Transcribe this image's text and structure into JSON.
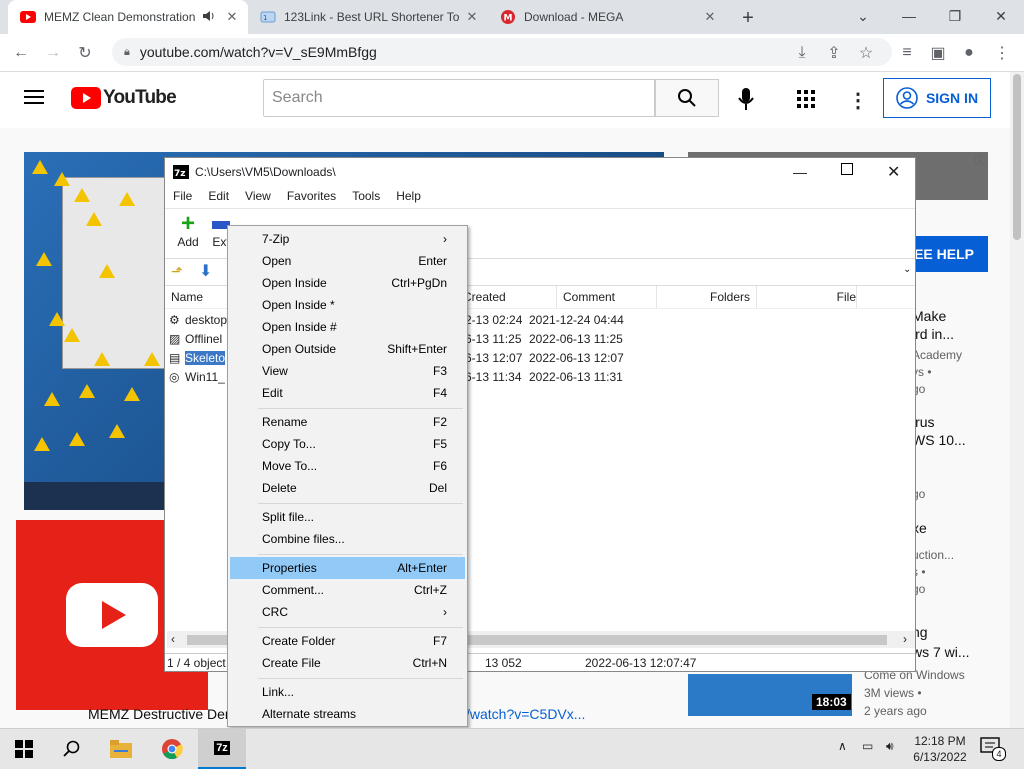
{
  "browser": {
    "tabs": [
      {
        "title": "MEMZ Clean Demonstration",
        "active": true,
        "favicon": "youtube-icon"
      },
      {
        "title": "123Link - Best URL Shortener To",
        "active": false,
        "favicon": "link-icon"
      },
      {
        "title": "Download - MEGA",
        "active": false,
        "favicon": "mega-icon"
      }
    ],
    "url": "youtube.com/watch?v=V_sE9MmBfgg"
  },
  "youtube": {
    "logo_text": "YouTube",
    "search_placeholder": "Search",
    "signin_label": "SIGN IN",
    "help_button": "SEE HELP",
    "sidebar": [
      {
        "title_line1": "Make",
        "title_line2": "ird in...",
        "meta1": "Academy",
        "meta2": "vs •",
        "meta3": "go"
      },
      {
        "title_line1": "irus",
        "title_line2": "WS 10...",
        "meta1": "",
        "meta2": "•",
        "meta3": "go"
      },
      {
        "title_line1": "xe",
        "title_line2": "",
        "meta1": "uction...",
        "meta2": "s •",
        "meta3": "go"
      },
      {
        "title_line1": "ng",
        "title_line2": "ws 7 wi...",
        "meta1": "Come on Windows",
        "meta2": "3M views •",
        "meta3": "2 years ago"
      }
    ],
    "duration": "18:03",
    "below_video_left": "MEMZ Destructive Der",
    "below_video_link": "/watch?v=C5DVx..."
  },
  "sevenzip": {
    "title": "C:\\Users\\VM5\\Downloads\\",
    "menu": [
      "File",
      "Edit",
      "View",
      "Favorites",
      "Tools",
      "Help"
    ],
    "toolbar": [
      "Add",
      "Ext"
    ],
    "columns": [
      "Name",
      "ed",
      "Created",
      "Comment",
      "Folders",
      "File"
    ],
    "rows": [
      {
        "name": "desktop",
        "modified": "2-13 02:24",
        "created": "2021-12-24 04:44"
      },
      {
        "name": "Offlinel",
        "modified": "6-13 11:25",
        "created": "2022-06-13 11:25"
      },
      {
        "name": "Skeleto",
        "modified": "6-13 12:07",
        "created": "2022-06-13 12:07"
      },
      {
        "name": "Win11_",
        "modified": "6-13 11:34",
        "created": "2022-06-13 11:31"
      }
    ],
    "status": {
      "selection": "1 / 4 object",
      "size": "13 052",
      "date": "2022-06-13 12:07:47"
    }
  },
  "context_menu": {
    "items": [
      {
        "label": "7-Zip",
        "shortcut": "",
        "submenu": true
      },
      {
        "label": "Open",
        "shortcut": "Enter"
      },
      {
        "label": "Open Inside",
        "shortcut": "Ctrl+PgDn"
      },
      {
        "label": "Open Inside *",
        "shortcut": ""
      },
      {
        "label": "Open Inside #",
        "shortcut": ""
      },
      {
        "label": "Open Outside",
        "shortcut": "Shift+Enter"
      },
      {
        "label": "View",
        "shortcut": "F3"
      },
      {
        "label": "Edit",
        "shortcut": "F4"
      },
      {
        "label": "Rename",
        "shortcut": "F2"
      },
      {
        "label": "Copy To...",
        "shortcut": "F5"
      },
      {
        "label": "Move To...",
        "shortcut": "F6"
      },
      {
        "label": "Delete",
        "shortcut": "Del"
      },
      {
        "label": "Split file...",
        "shortcut": ""
      },
      {
        "label": "Combine files...",
        "shortcut": ""
      },
      {
        "label": "Properties",
        "shortcut": "Alt+Enter",
        "highlighted": true
      },
      {
        "label": "Comment...",
        "shortcut": "Ctrl+Z"
      },
      {
        "label": "CRC",
        "shortcut": "",
        "submenu": true
      },
      {
        "label": "Create Folder",
        "shortcut": "F7"
      },
      {
        "label": "Create File",
        "shortcut": "Ctrl+N"
      },
      {
        "label": "Link...",
        "shortcut": ""
      },
      {
        "label": "Alternate streams",
        "shortcut": ""
      }
    ]
  },
  "taskbar": {
    "time": "12:18 PM",
    "date": "6/13/2022",
    "notifications": "4",
    "app_7z": "7z"
  },
  "colors": {
    "youtube_red": "#ff0000",
    "accent_blue": "#065fd4",
    "menu_highlight": "#91c9f7"
  }
}
